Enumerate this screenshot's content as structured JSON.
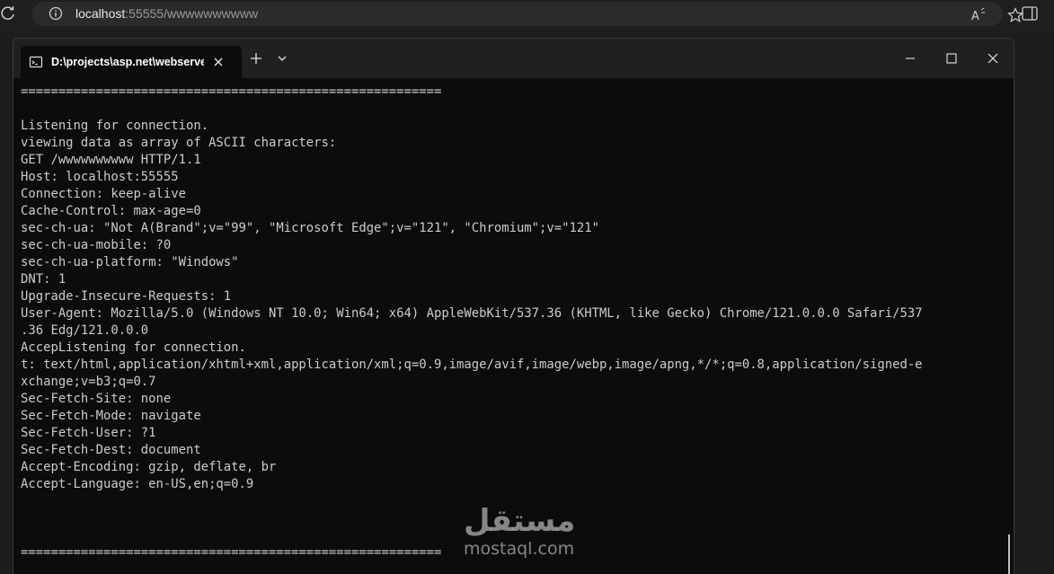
{
  "browser": {
    "url_host": "localhost",
    "url_path": ":55555/wwwwwwwwww",
    "icons": [
      "reload-icon",
      "info-icon",
      "read-aloud-icon",
      "favorite-icon",
      "sidebar-icon"
    ]
  },
  "terminal": {
    "tab_title": "D:\\projects\\asp.net\\webserve",
    "window_controls": [
      "minimize-icon",
      "maximize-icon",
      "close-icon"
    ],
    "output": "========================================================\n\nListening for connection.\nviewing data as array of ASCII characters:\nGET /wwwwwwwwww HTTP/1.1\nHost: localhost:55555\nConnection: keep-alive\nCache-Control: max-age=0\nsec-ch-ua: \"Not A(Brand\";v=\"99\", \"Microsoft Edge\";v=\"121\", \"Chromium\";v=\"121\"\nsec-ch-ua-mobile: ?0\nsec-ch-ua-platform: \"Windows\"\nDNT: 1\nUpgrade-Insecure-Requests: 1\nUser-Agent: Mozilla/5.0 (Windows NT 10.0; Win64; x64) AppleWebKit/537.36 (KHTML, like Gecko) Chrome/121.0.0.0 Safari/537\n.36 Edg/121.0.0.0\nAccepListening for connection.\nt: text/html,application/xhtml+xml,application/xml;q=0.9,image/avif,image/webp,image/apng,*/*;q=0.8,application/signed-e\nxchange;v=b3;q=0.7\nSec-Fetch-Site: none\nSec-Fetch-Mode: navigate\nSec-Fetch-User: ?1\nSec-Fetch-Dest: document\nAccept-Encoding: gzip, deflate, br\nAccept-Language: en-US,en;q=0.9\n\n\n\n========================================================"
  },
  "watermark": {
    "arabic": "مستقل",
    "latin": "mostaql.com"
  }
}
